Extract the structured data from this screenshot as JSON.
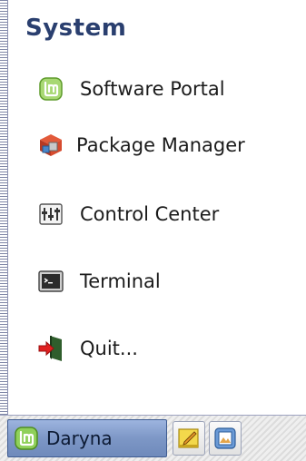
{
  "menu": {
    "section_title": "System",
    "items": [
      {
        "label": "Software Portal",
        "icon": "mint-software-icon"
      },
      {
        "label": "Package Manager",
        "icon": "package-manager-icon"
      },
      {
        "label": "Control Center",
        "icon": "control-center-icon"
      },
      {
        "label": "Terminal",
        "icon": "terminal-icon"
      },
      {
        "label": "Quit...",
        "icon": "quit-icon"
      }
    ]
  },
  "taskbar": {
    "window_button_label": "Daryna",
    "colors": {
      "mint_green": "#7fc24a",
      "accent_blue": "#7d97c6"
    }
  }
}
